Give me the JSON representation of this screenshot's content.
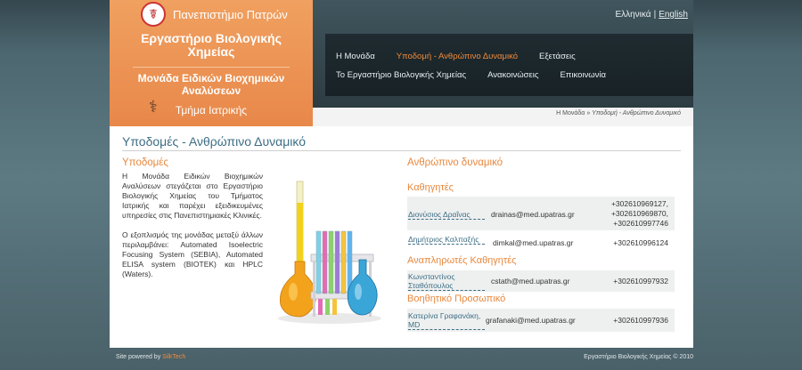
{
  "header": {
    "university": "Πανεπιστήμιο Πατρών",
    "lab_title": "Εργαστήριο Βιολογικής Χημείας",
    "unit_title": "Μονάδα Ειδικών Βιοχημικών Αναλύσεων",
    "department": "Τμήμα Ιατρικής"
  },
  "lang": {
    "el": "Ελληνικά",
    "sep": "|",
    "en": "English"
  },
  "nav": {
    "row1": [
      {
        "label": "Η Μονάδα",
        "active": false
      },
      {
        "label": "Υποδομή - Ανθρώπινο Δυναμικό",
        "active": true
      },
      {
        "label": "Εξετάσεις",
        "active": false
      }
    ],
    "row2": [
      {
        "label": "Το Εργαστήριο Βιολογικής Χημείας",
        "active": false
      },
      {
        "label": "Ανακοινώσεις",
        "active": false
      },
      {
        "label": "Επικοινωνία",
        "active": false
      }
    ]
  },
  "breadcrumb": {
    "home": "Η Μονάδα",
    "sep": "»",
    "current": "Υποδομή - Ανθρώπινο Δυναμικό"
  },
  "main": {
    "title": "Υποδομές - Ανθρώπινο Δυναμικό",
    "infra_heading": "Υποδομές",
    "infra_p1": "Η Μονάδα Ειδικών Βιοχημικών Αναλύσεων στεγάζεται στο Εργαστήριο Βιολογικής Χημείας του Τμήματος Ιατρικής και παρέχει εξειδικευμένες υπηρεσίες στις Πανεπιστημιακές Κλινικές.",
    "infra_p2": "Ο εξοπλισμός της μονάδας μεταξύ άλλων περιλαμβάνει: Automated Isoelectric Focusing System (SEBIA), Automated ELISA system (BIOTEK) και HPLC (Waters).",
    "staff_heading": "Ανθρώπινο δυναμικό",
    "groups": {
      "professors": "Καθηγητές",
      "associate": "Αναπληρωτές Καθηγητές",
      "support": "Βοηθητικό Προσωπικό"
    },
    "staff": [
      {
        "name": "Διονύσιος Δραΐνας",
        "email": "drainas@med.upatras.gr",
        "phones": [
          "+302610969127,",
          "+302610969870,",
          "+302610997746"
        ]
      },
      {
        "name": "Δημήτριος Καλπαξής",
        "email": "dimkal@med.upatras.gr",
        "phones": [
          "+302610996124"
        ]
      },
      {
        "name": "Κωνσταντίνος Σταθόπουλος",
        "email": "cstath@med.upatras.gr",
        "phones": [
          "+302610997932"
        ]
      },
      {
        "name": "Κατερίνα Γραφανάκη, MD",
        "email": "grafanaki@med.upatras.gr",
        "phones": [
          "+302610997936"
        ]
      }
    ]
  },
  "footer": {
    "powered_prefix": "Site powered by",
    "powered_brand": "SilkTech",
    "copyright": "Εργαστήριο Βιολογικής Χημείας © 2010"
  },
  "colors": {
    "accent": "#e8883e",
    "link": "#3d6e85",
    "nav_bg": "#1f2b30"
  }
}
